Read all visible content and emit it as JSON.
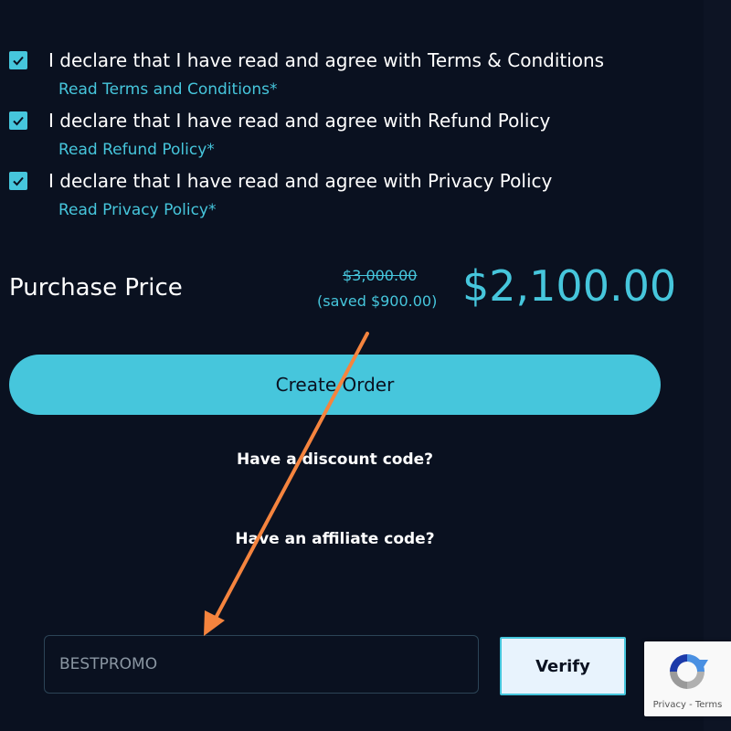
{
  "agreements": [
    {
      "text": "I declare that I have read and agree with Terms & Conditions",
      "link": "Read Terms and Conditions*",
      "checked": true
    },
    {
      "text": "I declare that I have read and agree with Refund Policy",
      "link": "Read Refund Policy*",
      "checked": true
    },
    {
      "text": "I declare that I have read and agree with Privacy Policy",
      "link": "Read Privacy Policy*",
      "checked": true
    }
  ],
  "price": {
    "label": "Purchase Price",
    "original": "$3,000.00",
    "saved": "(saved $900.00)",
    "current": "$2,100.00"
  },
  "create_order_label": "Create Order",
  "discount_prompt": "Have a discount code?",
  "affiliate_prompt": "Have an affiliate code?",
  "code_input": {
    "placeholder": "BESTPROMO",
    "value": ""
  },
  "verify_label": "Verify",
  "recaptcha": {
    "privacy": "Privacy",
    "separator": " - ",
    "terms": "Terms"
  },
  "colors": {
    "background": "#0a1120",
    "accent": "#46c6dc",
    "text": "#ffffff",
    "annotation_arrow": "#f5843e"
  },
  "icons": [
    "checkmark-icon",
    "recaptcha-icon",
    "annotation-arrow"
  ]
}
